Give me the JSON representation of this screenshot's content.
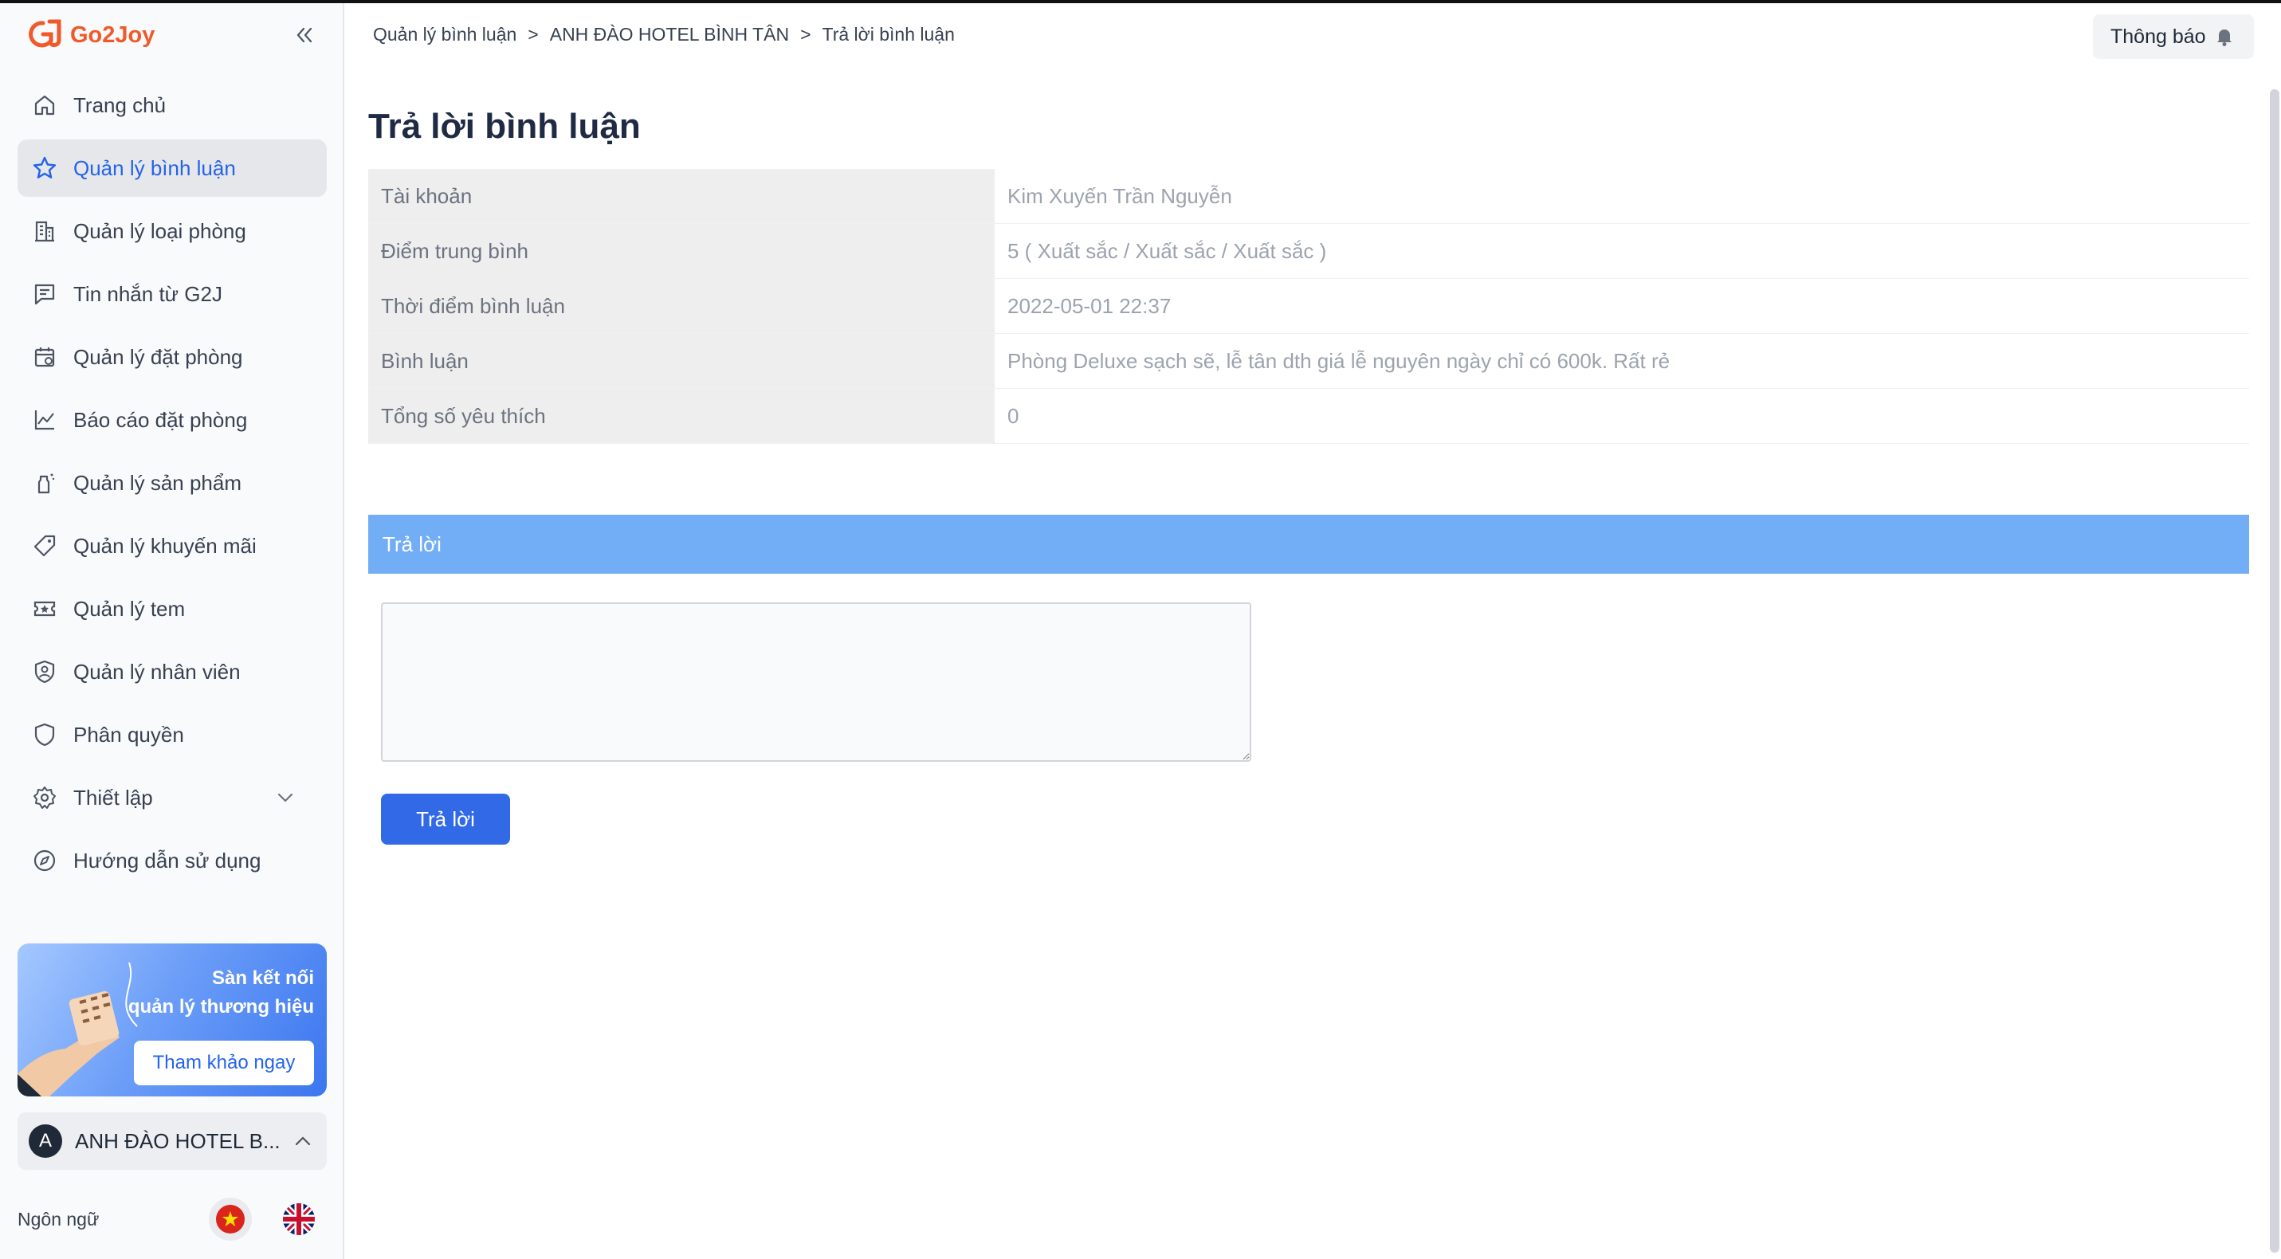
{
  "brand": {
    "name": "Go2Joy"
  },
  "sidebar": {
    "items": [
      {
        "label": "Trang chủ",
        "icon": "home-icon"
      },
      {
        "label": "Quản lý bình luận",
        "icon": "star-icon",
        "active": true
      },
      {
        "label": "Quản lý loại phòng",
        "icon": "building-icon"
      },
      {
        "label": "Tin nhắn từ G2J",
        "icon": "message-icon"
      },
      {
        "label": "Quản lý đặt phòng",
        "icon": "calendar-icon"
      },
      {
        "label": "Báo cáo đặt phòng",
        "icon": "chart-line-icon"
      },
      {
        "label": "Quản lý sản phẩm",
        "icon": "bottle-icon"
      },
      {
        "label": "Quản lý khuyến mãi",
        "icon": "tag-icon"
      },
      {
        "label": "Quản lý tem",
        "icon": "ticket-icon"
      },
      {
        "label": "Quản lý nhân viên",
        "icon": "user-shield-icon"
      },
      {
        "label": "Phân quyền",
        "icon": "shield-icon"
      },
      {
        "label": "Thiết lập",
        "icon": "gear-icon",
        "expandable": true
      },
      {
        "label": "Hướng dẫn sử dụng",
        "icon": "compass-icon"
      }
    ],
    "promo": {
      "line1": "Sàn kết nối",
      "line2": "quản lý thương hiệu",
      "button": "Tham khảo ngay"
    },
    "hotel": {
      "avatar": "A",
      "name": "ANH ĐÀO HOTEL B..."
    },
    "language": {
      "label": "Ngôn ngữ"
    }
  },
  "breadcrumb": {
    "items": [
      "Quản lý bình luận",
      "ANH ĐÀO HOTEL BÌNH TÂN",
      "Trả lời bình luận"
    ],
    "separator": ">"
  },
  "header": {
    "notify_label": "Thông báo"
  },
  "page": {
    "title": "Trả lời bình luận"
  },
  "details": [
    {
      "key": "Tài khoản",
      "value": "Kim Xuyến Trần Nguyễn"
    },
    {
      "key": "Điểm trung bình",
      "value": "5 ( Xuất sắc / Xuất sắc / Xuất sắc )"
    },
    {
      "key": "Thời điểm bình luận",
      "value": "2022-05-01 22:37"
    },
    {
      "key": "Bình luận",
      "value": "Phòng Deluxe sạch sẽ, lễ tân dth giá lễ nguyên ngày chỉ có 600k. Rất rẻ"
    },
    {
      "key": "Tổng số yêu thích",
      "value": "0"
    }
  ],
  "reply": {
    "header": "Trả lời",
    "textarea_value": "",
    "button": "Trả lời"
  },
  "colors": {
    "accent": "#2563eb",
    "brand": "#f0592a",
    "reply_header": "#72aef6",
    "button": "#3169e6"
  }
}
